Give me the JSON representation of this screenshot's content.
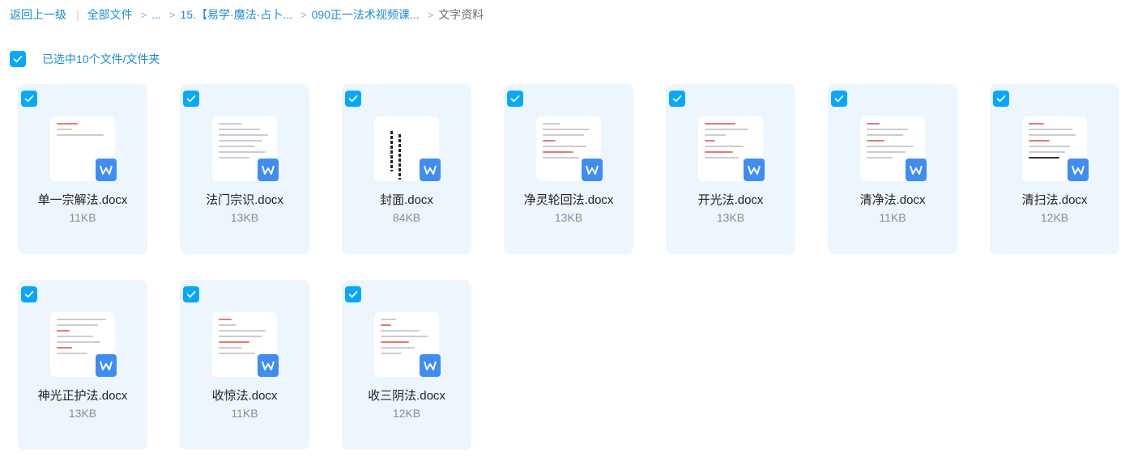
{
  "breadcrumb": {
    "back": "返回上一级",
    "all_files": "全部文件",
    "ellipsis": "...",
    "crumb_1": "15.【易学·魔法·占卜...",
    "crumb_2": "090正一法术视频课...",
    "current": "文字资料"
  },
  "selection": {
    "label": "已选中10个文件/文件夹"
  },
  "files": [
    {
      "name": "单一宗解法.docx",
      "size": "11KB"
    },
    {
      "name": "法门宗识.docx",
      "size": "13KB"
    },
    {
      "name": "封面.docx",
      "size": "84KB"
    },
    {
      "name": "净灵轮回法.docx",
      "size": "13KB"
    },
    {
      "name": "开光法.docx",
      "size": "13KB"
    },
    {
      "name": "清净法.docx",
      "size": "11KB"
    },
    {
      "name": "清扫法.docx",
      "size": "12KB"
    },
    {
      "name": "神光正护法.docx",
      "size": "13KB"
    },
    {
      "name": "收惊法.docx",
      "size": "11KB"
    },
    {
      "name": "收三阴法.docx",
      "size": "12KB"
    }
  ],
  "colors": {
    "accent": "#06a7ff",
    "card_bg": "#eef6fd",
    "word_blue": "#3f8cf4"
  }
}
